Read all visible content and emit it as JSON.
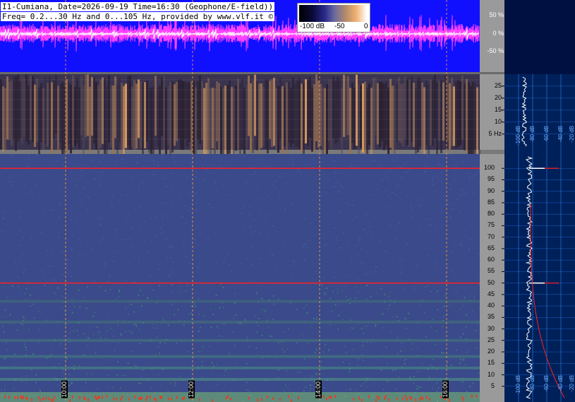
{
  "header": {
    "line1": "I1-Cumiana, Date=2026-09-19 Time=16:30 (Geophone/E-field))",
    "line2": "Freq= 0.2...30 Hz and 0...105 Hz, provided by www.vlf.it ©"
  },
  "colorbar": {
    "labels": [
      "-100 dB",
      "-50",
      "0"
    ],
    "colors": [
      "#000000",
      "#2a2a8c",
      "#6a6aa0",
      "#f0b070",
      "#ffffff"
    ]
  },
  "colors": {
    "waveform_bg": "#1010ff",
    "waveform_trace": "#ff40ff",
    "waveform_center": "#ffffff",
    "spectrogram_low_bg": "#3a3450",
    "spectrogram_high_bg": "#3a4a8a",
    "grid": "#ff9a40",
    "side_panel": "#00205a",
    "side_grid": "#2f8cff",
    "axis_panel": "#9a9a9a",
    "hline_red": "#ff2020"
  },
  "chart_data": [
    {
      "type": "line",
      "name": "waveform",
      "y_ticks": [
        "50 %",
        "0 %",
        "-50 %"
      ],
      "ylim": [
        -80,
        80
      ]
    },
    {
      "type": "heatmap",
      "name": "low-frequency spectrogram",
      "y_ticks": [
        "25",
        "20",
        "15",
        "10",
        "5 Hz"
      ],
      "ylim": [
        0.2,
        30
      ],
      "profile_ticks": [
        "-100 dB",
        "-80 dB",
        "-60 dB",
        "-40 dB",
        "-20 dB"
      ]
    },
    {
      "type": "heatmap",
      "name": "high-frequency spectrogram",
      "y_ticks": [
        "100",
        "95",
        "90",
        "85",
        "80",
        "75",
        "70",
        "65",
        "60",
        "55",
        "50",
        "45",
        "40",
        "35",
        "30",
        "25",
        "20",
        "15",
        "10",
        "5"
      ],
      "ylim": [
        0,
        105
      ],
      "x_ticks": [
        "10:00",
        "12:00",
        "14:00",
        "16:00"
      ],
      "lines_hz": [
        100,
        50
      ],
      "profile_ticks": [
        "-100 dB",
        "-80 dB",
        "-60 dB",
        "-40 dB",
        "-20 dB"
      ]
    }
  ]
}
